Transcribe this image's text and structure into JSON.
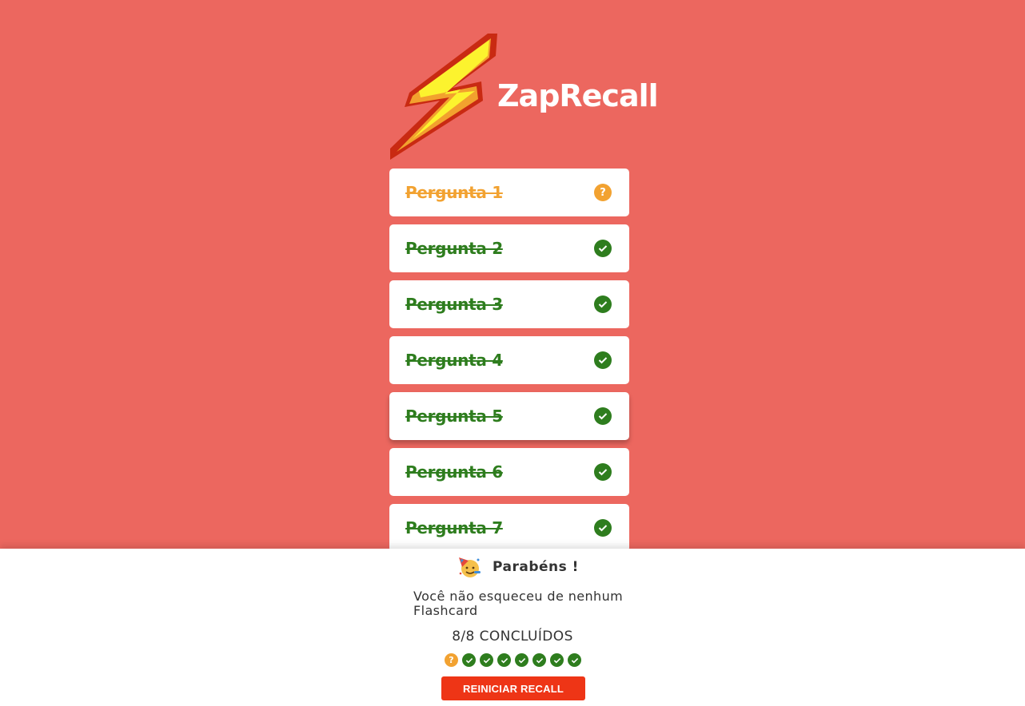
{
  "app": {
    "name": "ZapRecall"
  },
  "cards": [
    {
      "label": "Pergunta 1",
      "status": "almost",
      "icon": "help-circle-icon"
    },
    {
      "label": "Pergunta 2",
      "status": "correct",
      "icon": "check-circle-icon"
    },
    {
      "label": "Pergunta 3",
      "status": "correct",
      "icon": "check-circle-icon"
    },
    {
      "label": "Pergunta 4",
      "status": "correct",
      "icon": "check-circle-icon"
    },
    {
      "label": "Pergunta 5",
      "status": "correct",
      "icon": "check-circle-icon"
    },
    {
      "label": "Pergunta 6",
      "status": "correct",
      "icon": "check-circle-icon"
    },
    {
      "label": "Pergunta 7",
      "status": "correct",
      "icon": "check-circle-icon"
    }
  ],
  "footer": {
    "title": "Parabéns !",
    "message": "Você não esqueceu de nenhum Flashcard",
    "count": "8/8 CONCLUÍDOS",
    "results": [
      "almost",
      "correct",
      "correct",
      "correct",
      "correct",
      "correct",
      "correct",
      "correct"
    ],
    "restart_label": "REINICIAR RECALL"
  },
  "colors": {
    "background": "#EC675F",
    "correct": "#2E7D1E",
    "almost": "#F2A231",
    "button": "#EE3516"
  }
}
